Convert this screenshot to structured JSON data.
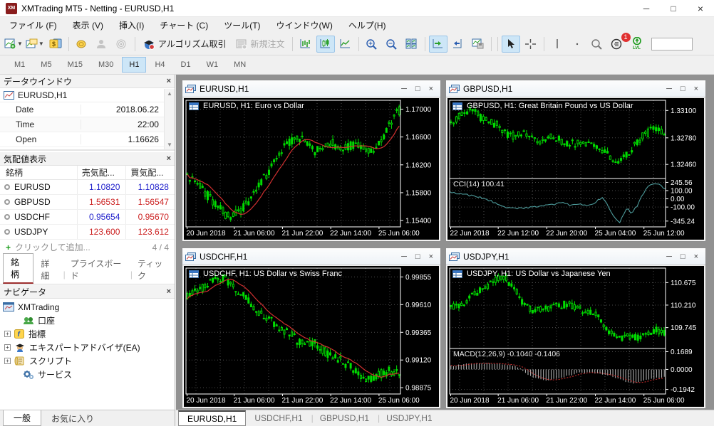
{
  "window": {
    "title": "XMTrading MT5 - Netting - EURUSD,H1",
    "logo": "XM"
  },
  "menu": {
    "items": [
      "ファイル (F)",
      "表示 (V)",
      "挿入(I)",
      "チャート (C)",
      "ツール(T)",
      "ウインドウ(W)",
      "ヘルプ(H)"
    ]
  },
  "toolbar": {
    "algo_label": "アルゴリズム取引",
    "new_order_label": "新規注文",
    "alert_badge": "1",
    "lvl_label": "LVL"
  },
  "timeframes": {
    "items": [
      {
        "t": "M1"
      },
      {
        "t": "M5"
      },
      {
        "t": "M15"
      },
      {
        "t": "M30"
      },
      {
        "t": "H1",
        "active": true
      },
      {
        "t": "H4"
      },
      {
        "t": "D1"
      },
      {
        "t": "W1"
      },
      {
        "t": "MN"
      }
    ]
  },
  "data_window": {
    "title": "データウインドウ",
    "symbol": "EURUSD,H1",
    "rows": [
      {
        "label": "Date",
        "value": "2018.06.22"
      },
      {
        "label": "Time",
        "value": "22:00"
      },
      {
        "label": "Open",
        "value": "1.16626"
      }
    ]
  },
  "market_watch": {
    "title": "気配値表示",
    "columns": {
      "symbol": "銘柄",
      "bid": "売気配...",
      "ask": "買気配..."
    },
    "rows": [
      {
        "symbol": "EURUSD",
        "bid": "1.10820",
        "ask": "1.10828",
        "bid_color": "#2222cc",
        "ask_color": "#2222cc"
      },
      {
        "symbol": "GBPUSD",
        "bid": "1.56531",
        "ask": "1.56547",
        "bid_color": "#cc2222",
        "ask_color": "#cc2222"
      },
      {
        "symbol": "USDCHF",
        "bid": "0.95654",
        "ask": "0.95670",
        "bid_color": "#2222cc",
        "ask_color": "#cc2222"
      },
      {
        "symbol": "USDJPY",
        "bid": "123.600",
        "ask": "123.612",
        "bid_color": "#cc2222",
        "ask_color": "#cc2222"
      }
    ],
    "add_hint": "クリックして追加...",
    "count": "4 / 4",
    "tabs": [
      {
        "t": "銘柄",
        "active": true
      },
      {
        "t": "詳細"
      },
      {
        "t": "プライスボード"
      },
      {
        "t": "ティック"
      }
    ]
  },
  "navigator": {
    "title": "ナビゲータ",
    "root": "XMTrading",
    "items": [
      "口座",
      "指標",
      "エキスパートアドバイザ(EA)",
      "スクリプト",
      "サービス"
    ]
  },
  "left_tabs": [
    {
      "t": "一般",
      "active": true
    },
    {
      "t": "お気に入り"
    }
  ],
  "chart_tabs": [
    {
      "t": "EURUSD,H1",
      "active": true
    },
    {
      "t": "USDCHF,H1"
    },
    {
      "t": "GBPUSD,H1"
    },
    {
      "t": "USDJPY,H1"
    }
  ],
  "chart_windows": [
    {
      "title": "EURUSD,H1",
      "header": "EURUSD, H1: Euro vs Dollar",
      "x_ticks": [
        {
          "t": "20 Jun 2018",
          "f": 0.005
        },
        {
          "t": "21 Jun 06:00",
          "f": 0.225
        },
        {
          "t": "21 Jun 22:00",
          "f": 0.45
        },
        {
          "t": "22 Jun 14:00",
          "f": 0.675
        },
        {
          "t": "25 Jun 06:00",
          "f": 0.9
        }
      ],
      "panels": [
        {
          "h": 1.0,
          "ticks": [
            {
              "t": "1.17000",
              "f": 0.07
            },
            {
              "t": "1.16600",
              "f": 0.29
            },
            {
              "t": "1.16200",
              "f": 0.51
            },
            {
              "t": "1.15800",
              "f": 0.73
            },
            {
              "t": "1.15400",
              "f": 0.95
            }
          ],
          "series": {
            "type": "candles",
            "n": 84,
            "seed": 11,
            "amp": 0.035,
            "ma": true,
            "ma_color": "#d03030",
            "color": "#00dc00",
            "path": [
              [
                0,
                0.6
              ],
              [
                0.06,
                0.68
              ],
              [
                0.13,
                0.82
              ],
              [
                0.2,
                0.93
              ],
              [
                0.26,
                0.86
              ],
              [
                0.33,
                0.7
              ],
              [
                0.4,
                0.52
              ],
              [
                0.47,
                0.34
              ],
              [
                0.53,
                0.3
              ],
              [
                0.6,
                0.4
              ],
              [
                0.67,
                0.33
              ],
              [
                0.74,
                0.39
              ],
              [
                0.8,
                0.33
              ],
              [
                0.86,
                0.4
              ],
              [
                0.91,
                0.34
              ],
              [
                0.95,
                0.2
              ],
              [
                1,
                0.08
              ]
            ]
          }
        }
      ]
    },
    {
      "title": "GBPUSD,H1",
      "header": "GBPUSD, H1: Great Britain Pound vs US Dollar",
      "x_ticks": [
        {
          "t": "22 Jun 2018",
          "f": 0.005
        },
        {
          "t": "22 Jun 12:00",
          "f": 0.225
        },
        {
          "t": "22 Jun 20:00",
          "f": 0.45
        },
        {
          "t": "25 Jun 04:00",
          "f": 0.675
        },
        {
          "t": "25 Jun 12:00",
          "f": 0.9
        }
      ],
      "panels": [
        {
          "h": 0.62,
          "ticks": [
            {
              "t": "1.33100",
              "f": 0.13
            },
            {
              "t": "1.32780",
              "f": 0.48
            },
            {
              "t": "1.32460",
              "f": 0.82
            }
          ],
          "series": {
            "type": "candles",
            "n": 80,
            "seed": 23,
            "amp": 0.05,
            "ma": false,
            "color": "#00dc00",
            "path": [
              [
                0,
                0.3
              ],
              [
                0.05,
                0.18
              ],
              [
                0.1,
                0.13
              ],
              [
                0.16,
                0.26
              ],
              [
                0.22,
                0.32
              ],
              [
                0.28,
                0.46
              ],
              [
                0.35,
                0.42
              ],
              [
                0.42,
                0.52
              ],
              [
                0.48,
                0.46
              ],
              [
                0.55,
                0.56
              ],
              [
                0.62,
                0.53
              ],
              [
                0.68,
                0.62
              ],
              [
                0.75,
                0.72
              ],
              [
                0.8,
                0.78
              ],
              [
                0.85,
                0.62
              ],
              [
                0.9,
                0.46
              ],
              [
                0.95,
                0.36
              ],
              [
                1,
                0.42
              ]
            ]
          }
        },
        {
          "h": 0.38,
          "label": "CCI(14) 100.41",
          "ticks": [
            {
              "t": "245.56",
              "f": 0.08
            },
            {
              "t": "100.00",
              "f": 0.25
            },
            {
              "t": "0.00",
              "f": 0.42
            },
            {
              "t": "-100.00",
              "f": 0.59
            },
            {
              "t": "-345.24",
              "f": 0.88
            }
          ],
          "series": {
            "type": "line",
            "color": "#4d9b9b",
            "seed": 5,
            "amp": 0.04,
            "path": [
              [
                0,
                0.28
              ],
              [
                0.08,
                0.34
              ],
              [
                0.15,
                0.4
              ],
              [
                0.2,
                0.48
              ],
              [
                0.25,
                0.58
              ],
              [
                0.3,
                0.62
              ],
              [
                0.36,
                0.6
              ],
              [
                0.42,
                0.57
              ],
              [
                0.47,
                0.55
              ],
              [
                0.52,
                0.5
              ],
              [
                0.56,
                0.56
              ],
              [
                0.6,
                0.52
              ],
              [
                0.64,
                0.58
              ],
              [
                0.68,
                0.47
              ],
              [
                0.71,
                0.4
              ],
              [
                0.74,
                0.62
              ],
              [
                0.77,
                0.85
              ],
              [
                0.79,
                0.9
              ],
              [
                0.82,
                0.6
              ],
              [
                0.84,
                0.72
              ],
              [
                0.87,
                0.55
              ],
              [
                0.9,
                0.28
              ],
              [
                0.93,
                0.12
              ],
              [
                0.96,
                0.1
              ],
              [
                0.98,
                0.16
              ],
              [
                1,
                0.22
              ]
            ]
          }
        }
      ]
    },
    {
      "title": "USDCHF,H1",
      "header": "USDCHF, H1: US Dollar vs Swiss Franc",
      "x_ticks": [
        {
          "t": "20 Jun 2018",
          "f": 0.005
        },
        {
          "t": "21 Jun 06:00",
          "f": 0.225
        },
        {
          "t": "21 Jun 22:00",
          "f": 0.45
        },
        {
          "t": "22 Jun 14:00",
          "f": 0.675
        },
        {
          "t": "25 Jun 06:00",
          "f": 0.9
        }
      ],
      "panels": [
        {
          "h": 1.0,
          "ticks": [
            {
              "t": "0.99855",
              "f": 0.07
            },
            {
              "t": "0.99610",
              "f": 0.29
            },
            {
              "t": "0.99365",
              "f": 0.51
            },
            {
              "t": "0.99120",
              "f": 0.73
            },
            {
              "t": "0.98875",
              "f": 0.95
            }
          ],
          "series": {
            "type": "candles",
            "n": 84,
            "seed": 17,
            "amp": 0.035,
            "ma": true,
            "ma_color": "#d03030",
            "color": "#00dc00",
            "path": [
              [
                0,
                0.22
              ],
              [
                0.06,
                0.18
              ],
              [
                0.12,
                0.1
              ],
              [
                0.18,
                0.08
              ],
              [
                0.24,
                0.18
              ],
              [
                0.3,
                0.28
              ],
              [
                0.36,
                0.38
              ],
              [
                0.42,
                0.45
              ],
              [
                0.48,
                0.52
              ],
              [
                0.54,
                0.6
              ],
              [
                0.6,
                0.58
              ],
              [
                0.66,
                0.68
              ],
              [
                0.72,
                0.72
              ],
              [
                0.78,
                0.8
              ],
              [
                0.84,
                0.88
              ],
              [
                0.9,
                0.85
              ],
              [
                0.95,
                0.82
              ],
              [
                1,
                0.84
              ]
            ]
          }
        }
      ]
    },
    {
      "title": "USDJPY,H1",
      "header": "USDJPY, H1: US Dollar vs Japanese Yen",
      "x_ticks": [
        {
          "t": "20 Jun 2018",
          "f": 0.005
        },
        {
          "t": "21 Jun 06:00",
          "f": 0.225
        },
        {
          "t": "21 Jun 22:00",
          "f": 0.45
        },
        {
          "t": "22 Jun 14:00",
          "f": 0.675
        },
        {
          "t": "25 Jun 06:00",
          "f": 0.9
        }
      ],
      "panels": [
        {
          "h": 0.64,
          "ticks": [
            {
              "t": "110.675",
              "f": 0.18
            },
            {
              "t": "110.210",
              "f": 0.46
            },
            {
              "t": "109.745",
              "f": 0.74
            }
          ],
          "series": {
            "type": "candles",
            "n": 82,
            "seed": 31,
            "amp": 0.045,
            "ma": false,
            "color": "#00dc00",
            "path": [
              [
                0,
                0.5
              ],
              [
                0.05,
                0.44
              ],
              [
                0.1,
                0.34
              ],
              [
                0.14,
                0.27
              ],
              [
                0.18,
                0.2
              ],
              [
                0.22,
                0.12
              ],
              [
                0.25,
                0.1
              ],
              [
                0.28,
                0.2
              ],
              [
                0.31,
                0.3
              ],
              [
                0.34,
                0.44
              ],
              [
                0.38,
                0.54
              ],
              [
                0.44,
                0.5
              ],
              [
                0.5,
                0.47
              ],
              [
                0.55,
                0.44
              ],
              [
                0.6,
                0.5
              ],
              [
                0.64,
                0.54
              ],
              [
                0.68,
                0.58
              ],
              [
                0.72,
                0.72
              ],
              [
                0.76,
                0.84
              ],
              [
                0.8,
                0.87
              ],
              [
                0.84,
                0.84
              ],
              [
                0.88,
                0.87
              ],
              [
                0.92,
                0.82
              ],
              [
                0.96,
                0.77
              ],
              [
                1,
                0.8
              ]
            ]
          }
        },
        {
          "h": 0.36,
          "label": "MACD(12,26,9) -0.1040 -0.1406",
          "ticks": [
            {
              "t": "0.1689",
              "f": 0.07
            },
            {
              "t": "0.0000",
              "f": 0.46
            },
            {
              "t": "-0.1942",
              "f": 0.9
            }
          ],
          "series": {
            "type": "macd",
            "n": 84,
            "seed": 41,
            "zero": 0.46,
            "amp": 0.03,
            "color": "#bdbdbd",
            "signal_color": "#d83030",
            "path": [
              [
                0,
                0.38
              ],
              [
                0.06,
                0.35
              ],
              [
                0.12,
                0.32
              ],
              [
                0.18,
                0.32
              ],
              [
                0.24,
                0.34
              ],
              [
                0.3,
                0.38
              ],
              [
                0.33,
                0.46
              ],
              [
                0.36,
                0.58
              ],
              [
                0.4,
                0.66
              ],
              [
                0.45,
                0.7
              ],
              [
                0.5,
                0.66
              ],
              [
                0.55,
                0.6
              ],
              [
                0.6,
                0.54
              ],
              [
                0.65,
                0.52
              ],
              [
                0.7,
                0.55
              ],
              [
                0.75,
                0.6
              ],
              [
                0.8,
                0.7
              ],
              [
                0.85,
                0.76
              ],
              [
                0.9,
                0.72
              ],
              [
                0.95,
                0.66
              ],
              [
                1,
                0.63
              ]
            ]
          }
        }
      ]
    }
  ]
}
